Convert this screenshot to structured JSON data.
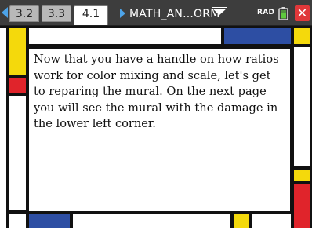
{
  "header": {
    "tabs": [
      {
        "label": "3.2",
        "active": false
      },
      {
        "label": "3.3",
        "active": false
      },
      {
        "label": "4.1",
        "active": true
      }
    ],
    "document_name": "MATH_AN...ORM",
    "angle_mode": "RAD",
    "icons": [
      "nav-left-arrow",
      "doc-arrow",
      "dropdown-icon",
      "battery-icon",
      "close-icon"
    ]
  },
  "content": {
    "text": "Now that you have a handle on how ratios work for color mixing and scale, let's get to reparing the mural. On the next page you will see the mural with the damage in the lower left corner."
  },
  "colors": {
    "yellow": "#f4d90c",
    "red": "#e0242b",
    "blue": "#2d4ea3",
    "black": "#111111",
    "topbar": "#3d3d3d",
    "accent": "#4da3e8"
  }
}
